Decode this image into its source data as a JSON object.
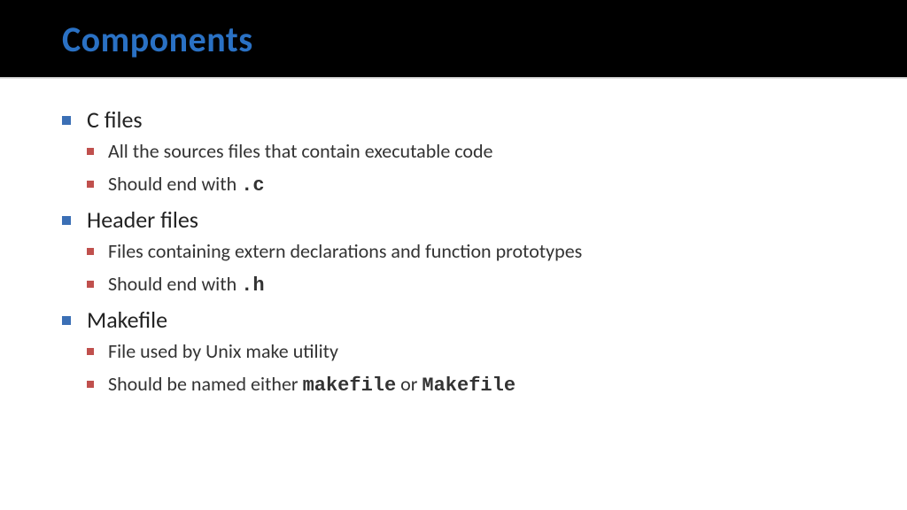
{
  "title": "Components",
  "bullets": [
    {
      "label": "C files",
      "sub": [
        {
          "parts": [
            "All the sources files that contain executable code"
          ]
        },
        {
          "parts": [
            "Should end with ",
            {
              "mono": ".c"
            }
          ]
        }
      ]
    },
    {
      "label": "Header files",
      "sub": [
        {
          "parts": [
            "Files containing extern declarations and function prototypes"
          ]
        },
        {
          "parts": [
            "Should end with ",
            {
              "mono": ".h"
            }
          ]
        }
      ]
    },
    {
      "label": "Makefile",
      "sub": [
        {
          "parts": [
            "File used by Unix make utility"
          ]
        },
        {
          "parts": [
            "Should be named either ",
            {
              "mono": "makefile"
            },
            " or ",
            {
              "mono": "Makefile"
            }
          ]
        }
      ]
    }
  ]
}
